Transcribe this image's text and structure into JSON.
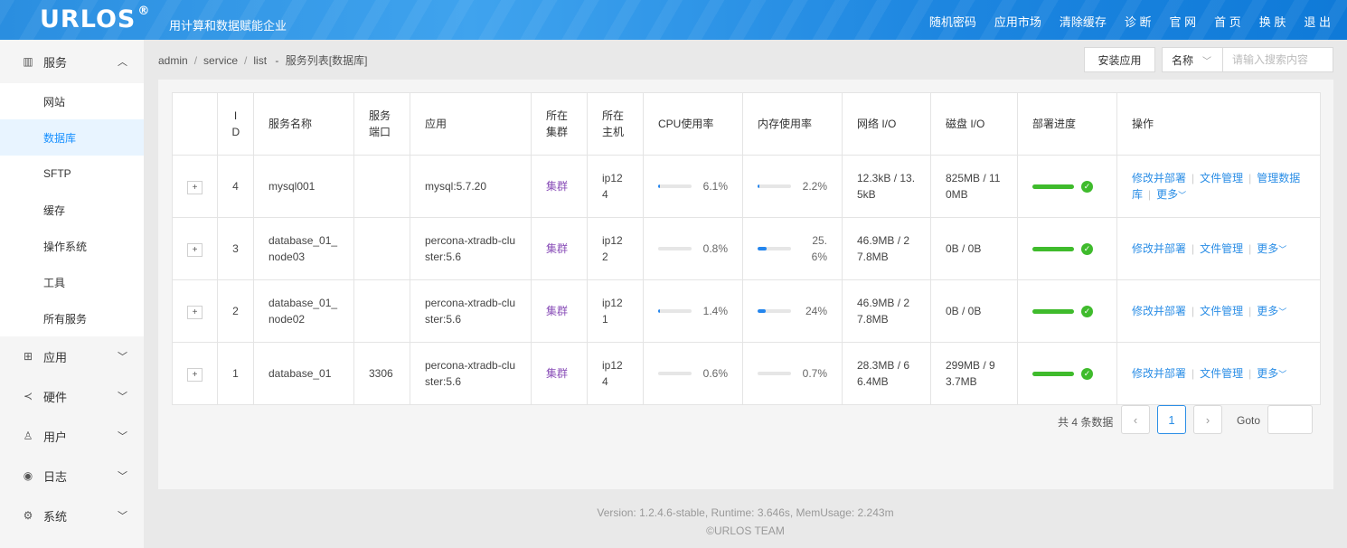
{
  "header": {
    "logo": "URLOS",
    "logo_mark": "®",
    "slogan": "用计算和数据赋能企业",
    "nav": [
      "随机密码",
      "应用市场",
      "清除缓存",
      "诊 断",
      "官 网",
      "首 页",
      "换 肤",
      "退 出"
    ]
  },
  "sidebar": {
    "service_group": "服务",
    "service_items": [
      "网站",
      "数据库",
      "SFTP",
      "缓存",
      "操作系统",
      "工具",
      "所有服务"
    ],
    "groups": [
      "应用",
      "硬件",
      "用户",
      "日志",
      "系统"
    ]
  },
  "breadcrumb": {
    "items": [
      "admin",
      "service",
      "list"
    ],
    "current": "服务列表[数据库]"
  },
  "toolbar": {
    "install_label": "安装应用",
    "search_field": "名称",
    "search_placeholder": "请输入搜索内容"
  },
  "table": {
    "headers": [
      "",
      "I D",
      "服务名称",
      "服务端口",
      "应用",
      "所在集群",
      "所在主机",
      "CPU使用率",
      "内存使用率",
      "网络 I/O",
      "磁盘 I/O",
      "部署进度",
      "操作"
    ],
    "rows": [
      {
        "expand": "+",
        "id": "4",
        "name": "mysql001",
        "port": "",
        "app": "mysql:5.7.20",
        "cluster": "集群",
        "host": "ip124",
        "cpu": "6.1%",
        "cpu_val": 6.1,
        "mem": "2.2%",
        "mem_val": 2.2,
        "net": "12.3kB / 13.5kB",
        "disk": "825MB / 110MB",
        "ops": [
          "修改并部署",
          "文件管理",
          "管理数据库",
          "更多"
        ]
      },
      {
        "expand": "+",
        "id": "3",
        "name": "database_01_node03",
        "port": "",
        "app": "percona-xtradb-cluster:5.6",
        "cluster": "集群",
        "host": "ip122",
        "cpu": "0.8%",
        "cpu_val": 0.8,
        "mem": "25.6%",
        "mem_val": 25.6,
        "net": "46.9MB / 27.8MB",
        "disk": "0B / 0B",
        "ops": [
          "修改并部署",
          "文件管理",
          "更多"
        ]
      },
      {
        "expand": "+",
        "id": "2",
        "name": "database_01_node02",
        "port": "",
        "app": "percona-xtradb-cluster:5.6",
        "cluster": "集群",
        "host": "ip121",
        "cpu": "1.4%",
        "cpu_val": 1.4,
        "mem": "24%",
        "mem_val": 24,
        "net": "46.9MB / 27.8MB",
        "disk": "0B / 0B",
        "ops": [
          "修改并部署",
          "文件管理",
          "更多"
        ]
      },
      {
        "expand": "+",
        "id": "1",
        "name": "database_01",
        "port": "3306",
        "app": "percona-xtradb-cluster:5.6",
        "cluster": "集群",
        "host": "ip124",
        "cpu": "0.6%",
        "cpu_val": 0.6,
        "mem": "0.7%",
        "mem_val": 0.7,
        "net": "28.3MB / 66.4MB",
        "disk": "299MB / 93.7MB",
        "ops": [
          "修改并部署",
          "文件管理",
          "更多"
        ]
      }
    ]
  },
  "pagination": {
    "total_text": "共 4 条数据",
    "prev": "‹",
    "current_page": "1",
    "next": "›",
    "goto_label": "Goto"
  },
  "footer": {
    "line1": "Version: 1.2.4.6-stable,   Runtime: 3.646s,   MemUsage: 2.243m",
    "line2": "©URLOS TEAM"
  },
  "colors": {
    "accent": "#2b8ee6",
    "header": "#2a8ee0",
    "success": "#3fbb2c",
    "cluster": "#8a4fb8"
  }
}
